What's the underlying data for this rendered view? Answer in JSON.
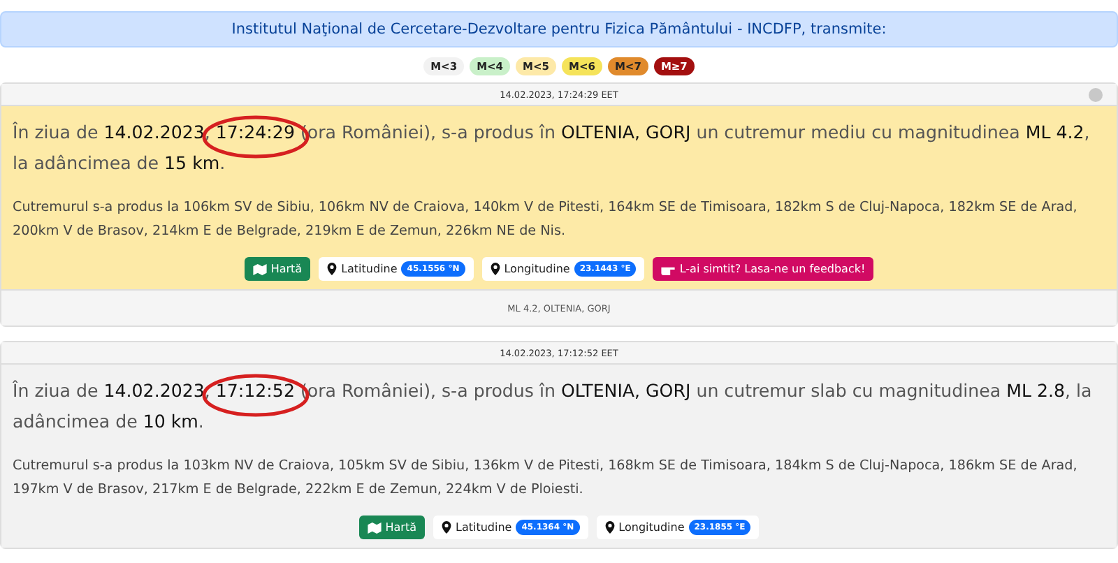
{
  "banner": "Institutul Naţional de Cercetare-Dezvoltare pentru Fizica Pământului - INCDFP, transmite:",
  "legend": [
    {
      "label": "M<3",
      "color": "#f2f2f2"
    },
    {
      "label": "M<4",
      "color": "#c9f0c9"
    },
    {
      "label": "M<5",
      "color": "#fde9a8"
    },
    {
      "label": "M<6",
      "color": "#f5e35a"
    },
    {
      "label": "M<7",
      "color": "#e08a2c"
    },
    {
      "label": "M≥7",
      "color": "#a30f0f"
    }
  ],
  "events": [
    {
      "header": "14.02.2023, 17:24:29 EET",
      "status_dot": true,
      "color": "#fdeaa7",
      "before": "În ziua de **14.02.2023**, ",
      "time": "17:24:29",
      "highlighted": true,
      "after": " (ora României), s-a produs în **OLTENIA, GORJ** un cutremur mediu cu magnitudinea **ML 4.2**, la adâncimea de **15 km**.",
      "distances": "Cutremurul s-a produs la 106km SV de Sibiu, 106km NV de Craiova, 140km V de Pitesti, 164km SE de Timisoara, 182km S de Cluj-Napoca, 182km SE de Arad, 200km V de Brasov, 214km E de Belgrade, 219km E de Zemun, 226km NE de Nis.",
      "map_button": "Hartă",
      "latitude_label": "Latitudine",
      "latitude": "45.1556 °N",
      "longitude_label": "Longitudine",
      "longitude": "23.1443 °E",
      "feedback_button": "L-ai simtit? Lasa-ne un feedback!",
      "footer": "ML 4.2, OLTENIA, GORJ"
    },
    {
      "header": "14.02.2023, 17:12:52 EET",
      "status_dot": false,
      "color": "#f2f2f2",
      "before": "În ziua de **14.02.2023**, ",
      "time": "17:12:52",
      "highlighted": true,
      "after": " (ora României), s-a produs în **OLTENIA, GORJ** un cutremur slab cu magnitudinea **ML 2.8**, la adâncimea de **10 km**.",
      "distances": "Cutremurul s-a produs la 103km NV de Craiova, 105km SV de Sibiu, 136km V de Pitesti, 168km SE de Timisoara, 184km S de Cluj-Napoca, 186km SE de Arad, 197km V de Brasov, 217km E de Belgrade, 222km E de Zemun, 224km V de Ploiesti.",
      "map_button": "Hartă",
      "latitude_label": "Latitudine",
      "latitude": "45.1364 °N",
      "longitude_label": "Longitudine",
      "longitude": "23.1855 °E"
    }
  ]
}
